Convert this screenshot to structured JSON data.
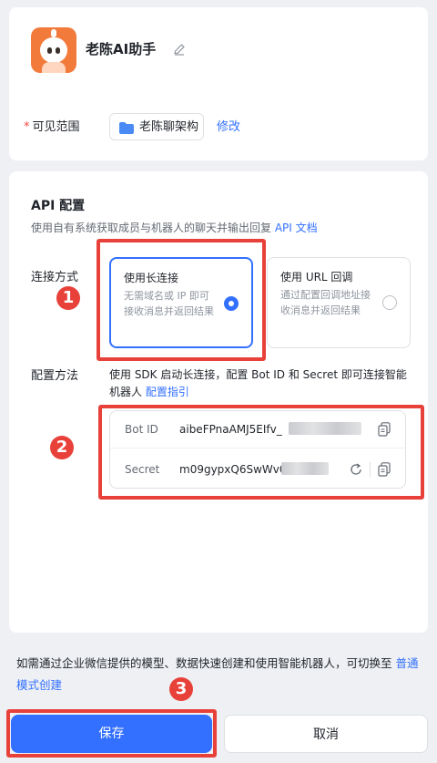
{
  "bot": {
    "name": "老陈AI助手"
  },
  "scope": {
    "required_mark": "*",
    "label": "可见范围",
    "value": "老陈聊架构",
    "modify_link": "修改"
  },
  "api_section": {
    "title": "API 配置",
    "description": "使用自有系统获取成员与机器人的聊天并输出回复",
    "doc_link": "API 文档",
    "connection_label": "连接方式",
    "options": [
      {
        "title": "使用长连接",
        "description": "无需域名或 IP 即可接收消息并返回结果",
        "selected": true
      },
      {
        "title": "使用 URL 回调",
        "description": "通过配置回调地址接收消息并返回结果",
        "selected": false
      }
    ],
    "method_label": "配置方法",
    "method_text": "使用 SDK 启动长连接，配置 Bot ID 和 Secret 即可连接智能机器人",
    "guide_link": "配置指引",
    "bot_id_label": "Bot ID",
    "bot_id_value": "aibeFPnaAMJ5EIfv_",
    "secret_label": "Secret",
    "secret_value": "m09gypxQ6SwWv0"
  },
  "annotations": [
    "1",
    "2",
    "3"
  ],
  "footer": {
    "note": "如需通过企业微信提供的模型、数据快速创建和使用智能机器人，可切换至",
    "note_link": "普通模式创建"
  },
  "buttons": {
    "save": "保存",
    "cancel": "取消"
  },
  "colors": {
    "accent": "#3370ff",
    "highlight": "#e8413a",
    "avatar": "#f27b3c"
  }
}
